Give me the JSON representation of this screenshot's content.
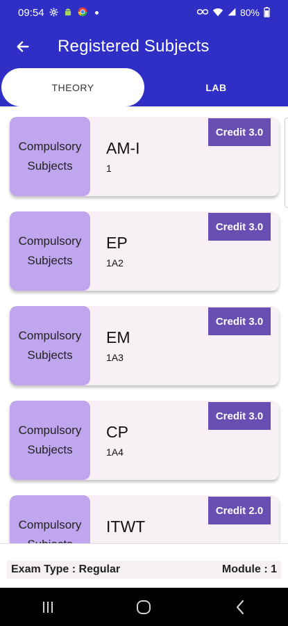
{
  "status": {
    "time": "09:54",
    "battery": "80%"
  },
  "app_bar": {
    "title": "Registered Subjects"
  },
  "tabs": [
    {
      "label": "THEORY",
      "active": true
    },
    {
      "label": "LAB",
      "active": false
    }
  ],
  "subjects": [
    {
      "category": "Compulsory Subjects",
      "name": "AM-I",
      "code": "1",
      "credit": "Credit 3.0"
    },
    {
      "category": "Compulsory Subjects",
      "name": "EP",
      "code": "1A2",
      "credit": "Credit 3.0"
    },
    {
      "category": "Compulsory Subjects",
      "name": "EM",
      "code": "1A3",
      "credit": "Credit 3.0"
    },
    {
      "category": "Compulsory Subjects",
      "name": "CP",
      "code": "1A4",
      "credit": "Credit 3.0"
    },
    {
      "category": "Compulsory Subjects",
      "name": "ITWT",
      "code": "",
      "credit": "Credit 2.0"
    }
  ],
  "footer": {
    "exam_type": "Exam Type : Regular",
    "module": "Module : 1"
  },
  "colors": {
    "primary": "#2f2fc6",
    "category_bg": "#bfa6ee",
    "credit_bg": "#6a4fb3",
    "card_bg": "#f7f1f6"
  }
}
